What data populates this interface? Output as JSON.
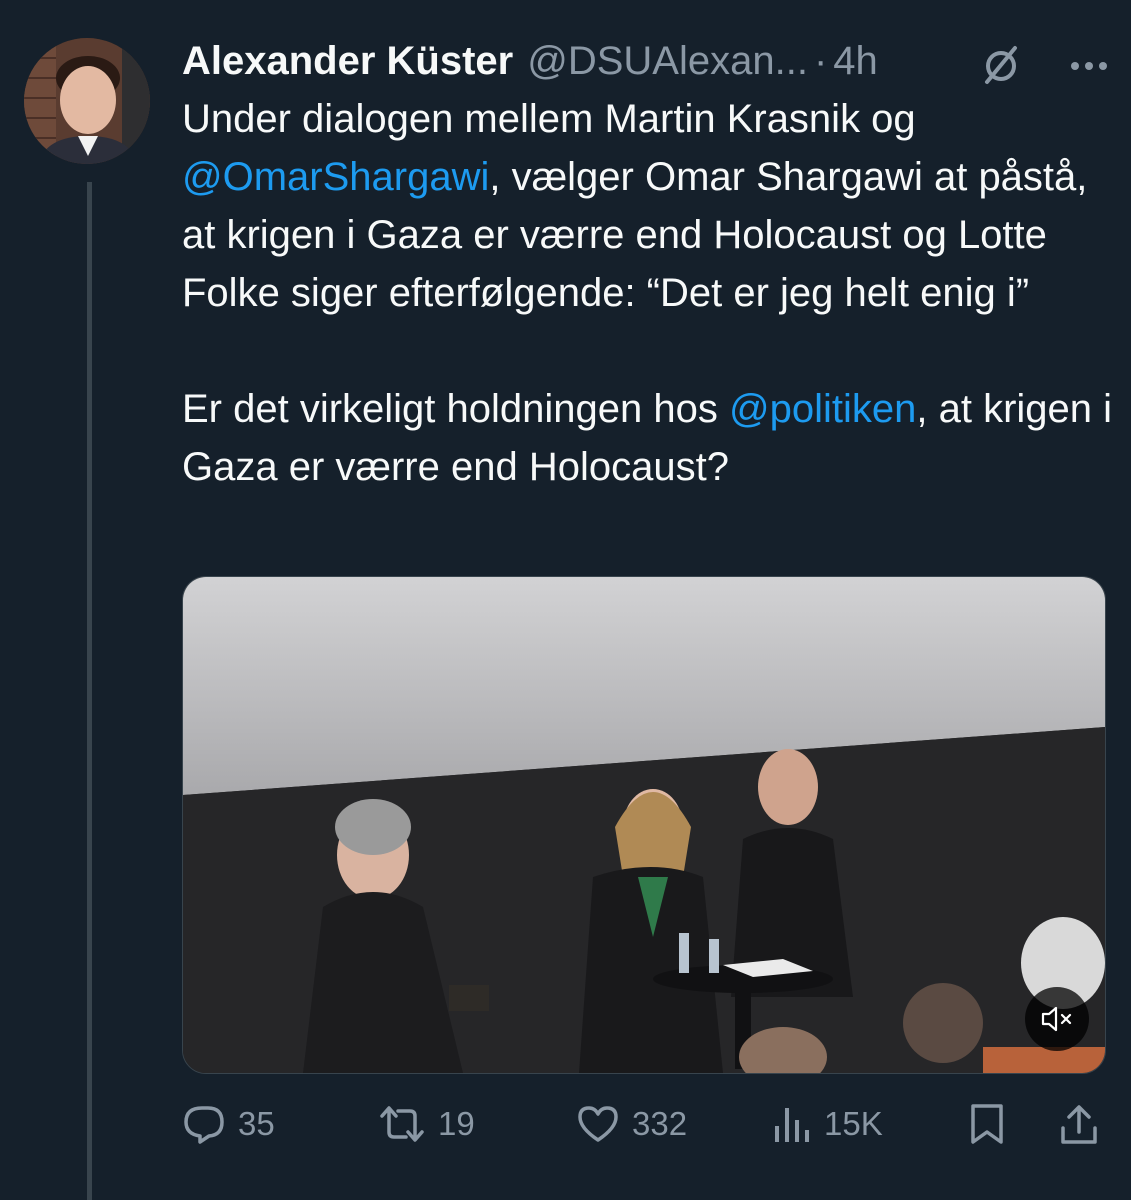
{
  "tweet": {
    "author_name": "Alexander Küster",
    "author_handle": "@DSUAlexan...",
    "separator": "·",
    "time": "4h",
    "icons": {
      "grok": "grok-slash-icon",
      "more": "more-dots-icon"
    },
    "text": {
      "p1_before": "Under dialogen mellem Martin Krasnik og ",
      "mention1": "@OmarShargawi",
      "p1_after": ", vælger Omar Shargawi at påstå, at krigen i Gaza er værre end Holocaust og Lotte Folke siger efterfølgende: “Det er jeg helt enig i”",
      "p2_before": "Er det virkeligt holdningen hos ",
      "mention2": "@politiken",
      "p2_after": ", at krigen i Gaza er værre end Holocaust?"
    },
    "media": {
      "type": "video",
      "mute_icon": "muted-speaker-icon"
    },
    "actions": {
      "replies": "35",
      "retweets": "19",
      "likes": "332",
      "views": "15K"
    }
  },
  "colors": {
    "background": "#15202b",
    "text": "#f7f9f9",
    "secondary": "#8b98a5",
    "mention": "#1d9bf0",
    "divider": "#38444d"
  }
}
